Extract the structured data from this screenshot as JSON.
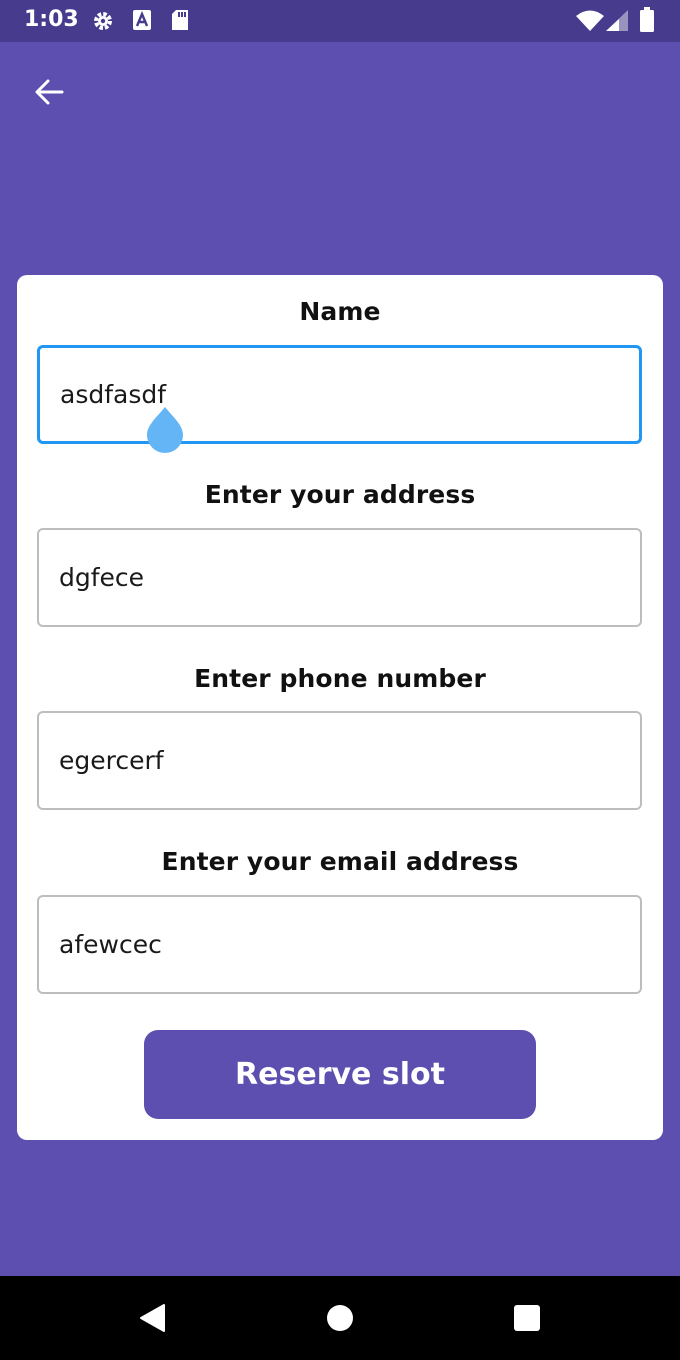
{
  "status_bar": {
    "time": "1:03",
    "icons": [
      "gear-icon",
      "font-a-icon",
      "sd-card-icon",
      "wifi-icon",
      "signal-icon",
      "battery-icon"
    ]
  },
  "header": {
    "back_icon": "arrow-left-icon"
  },
  "form": {
    "fields": [
      {
        "label": "Name",
        "value": "asdfasdf",
        "focused": true
      },
      {
        "label": "Enter your address",
        "value": "dgfece"
      },
      {
        "label": "Enter phone number",
        "value": "egercerf"
      },
      {
        "label": "Enter your email address",
        "value": "afewcec"
      }
    ],
    "submit_label": "Reserve slot"
  },
  "nav_bar": {
    "icons": [
      "back-triangle-icon",
      "home-circle-icon",
      "recents-square-icon"
    ]
  },
  "colors": {
    "primary": "#5c4fb0",
    "status_bar": "#463b8c",
    "focus_border": "#2196f3",
    "cursor_handle": "#64b5f6"
  }
}
